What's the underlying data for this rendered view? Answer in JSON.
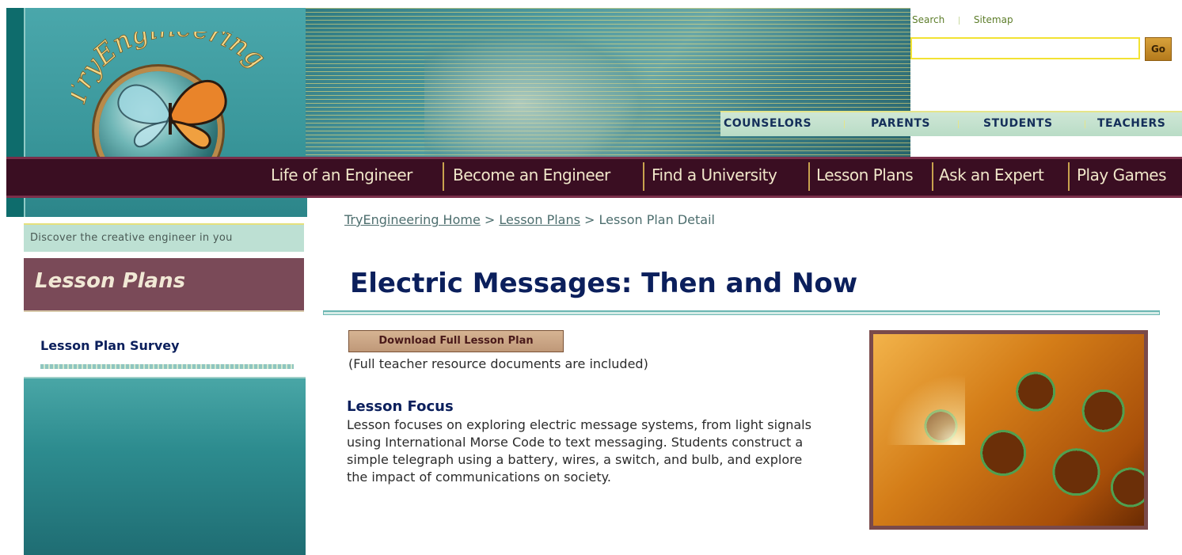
{
  "header": {
    "site_name": "TryEngineering",
    "utility_links": [
      "Search",
      "Sitemap"
    ],
    "search": {
      "value": "",
      "placeholder": ""
    },
    "go_label": "Go",
    "audience_tabs": [
      "COUNSELORS",
      "PARENTS",
      "STUDENTS",
      "TEACHERS"
    ],
    "main_nav": [
      "Life of an Engineer",
      "Become an Engineer",
      "Find a University",
      "Lesson Plans",
      "Ask an Expert",
      "Play Games"
    ],
    "tagline": "Discover the creative engineer in you"
  },
  "sidebar": {
    "section_title": "Lesson Plans",
    "links": [
      "Lesson Plan Survey"
    ]
  },
  "breadcrumb": {
    "items": [
      "TryEngineering Home",
      "Lesson Plans"
    ],
    "current": "Lesson Plan Detail",
    "separator": ">"
  },
  "main": {
    "title": "Electric Messages: Then and Now",
    "download_label": "Download Full Lesson Plan",
    "download_note": "(Full teacher resource documents are included)",
    "focus_heading": "Lesson Focus",
    "focus_text": "Lesson focuses on exploring electric message systems, from light signals using International Morse Code to text messaging. Students construct a simple telegraph using a battery, wires, a switch, and bulb, and explore the impact of communications on society."
  },
  "colors": {
    "title_navy": "#0b1f5c",
    "nav_bg": "#3a0e22",
    "teal": "#2d8c8f",
    "section_header_bg": "#7a4a58"
  }
}
